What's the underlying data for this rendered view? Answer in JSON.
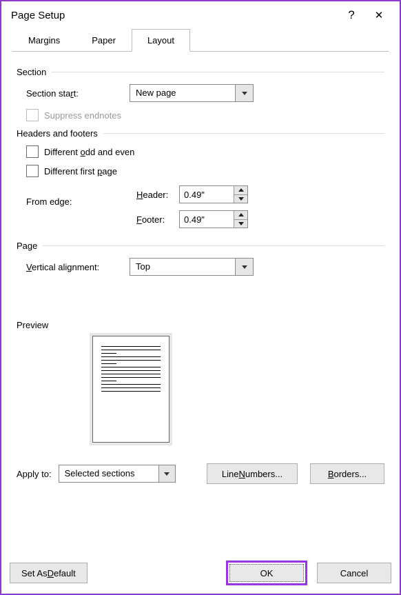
{
  "titlebar": {
    "title": "Page Setup",
    "help": "?",
    "close": "✕"
  },
  "tabs": {
    "margins": "Margins",
    "paper": "Paper",
    "layout": "Layout"
  },
  "section": {
    "head": "Section",
    "start_label": "Section start:",
    "start_value": "New page",
    "suppress": "Suppress endnotes"
  },
  "hf": {
    "head": "Headers and footers",
    "odd_even": "Different odd and even",
    "first_page": "Different first page",
    "from_edge": "From edge:",
    "header_label": "Header:",
    "header_value": "0.49\"",
    "footer_label": "Footer:",
    "footer_value": "0.49\""
  },
  "page": {
    "head": "Page",
    "valign_label": "Vertical alignment:",
    "valign_value": "Top"
  },
  "preview": {
    "head": "Preview"
  },
  "apply": {
    "label": "Apply to:",
    "value": "Selected sections",
    "line_numbers": "Line Numbers...",
    "borders": "Borders..."
  },
  "buttons": {
    "default": "Set As Default",
    "ok": "OK",
    "cancel": "Cancel"
  }
}
